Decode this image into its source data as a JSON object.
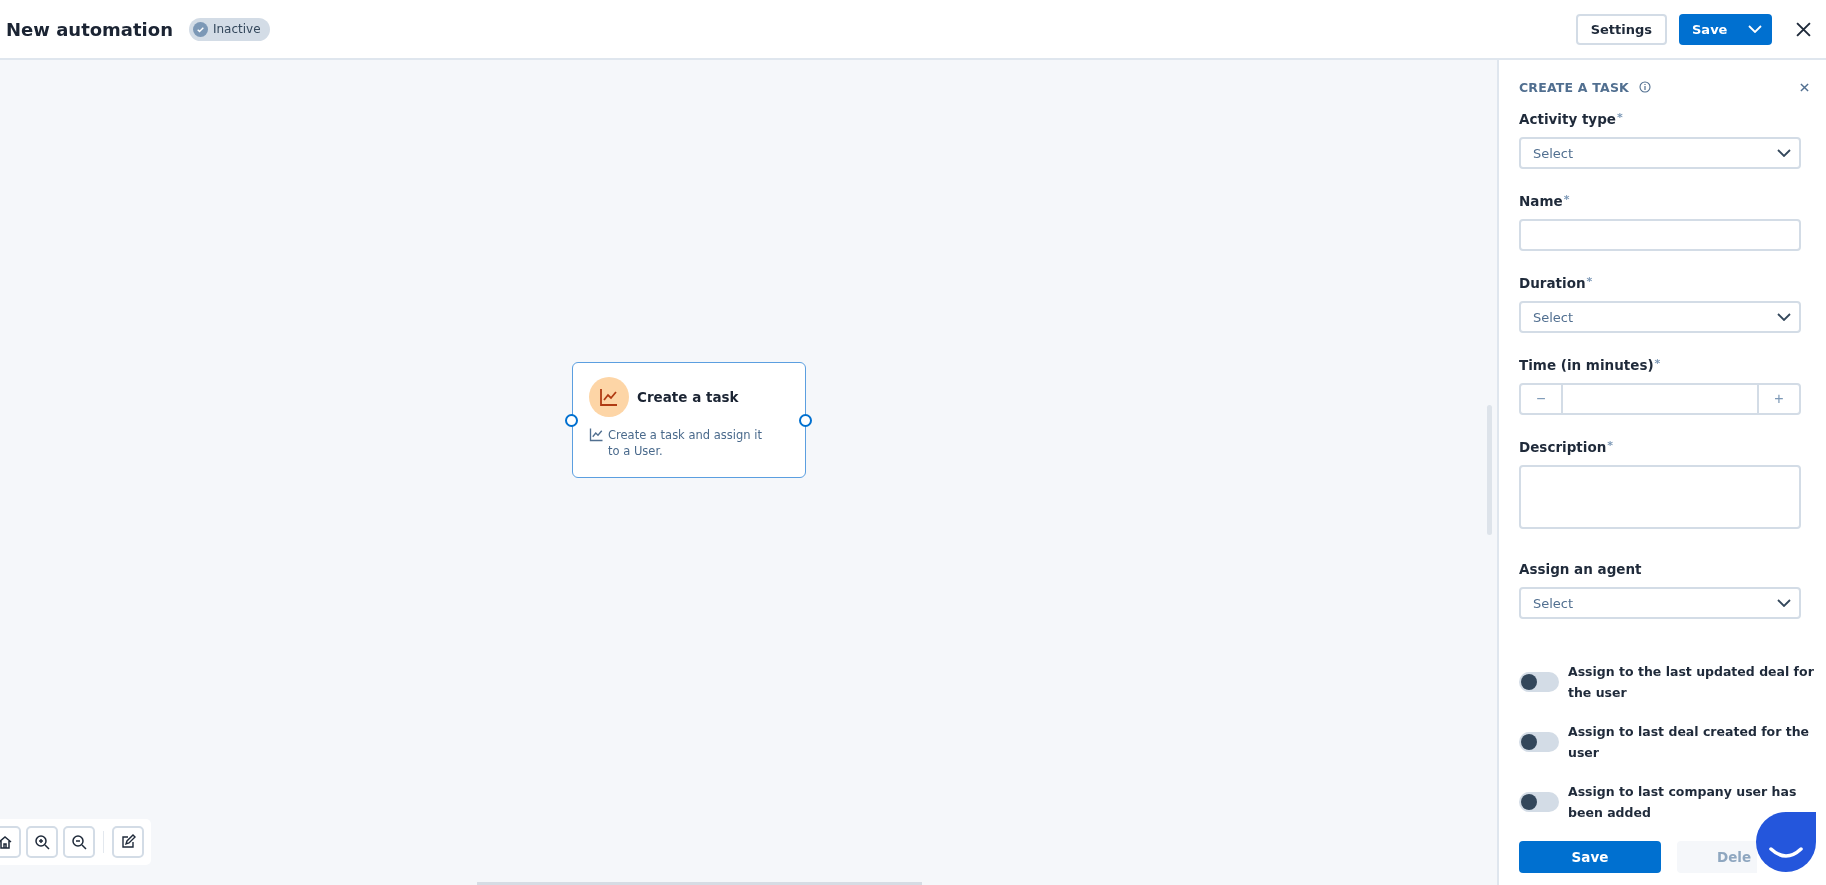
{
  "header": {
    "title": "New automation",
    "status": {
      "label": "Inactive",
      "active": false
    },
    "settings_button": "Settings",
    "save_button": "Save"
  },
  "canvas": {
    "node": {
      "title": "Create a task",
      "description": "Create a task and assign it to a User.",
      "selected": true
    }
  },
  "panel": {
    "title": "CREATE A TASK",
    "fields": [
      {
        "kind": "select",
        "label": "Activity type",
        "required_mark": "*",
        "placeholder": "Select"
      },
      {
        "kind": "text",
        "label": "Name",
        "required_mark": "*"
      },
      {
        "kind": "select",
        "label": "Duration",
        "required_mark": "*",
        "placeholder": "Select"
      },
      {
        "kind": "stepper",
        "label": "Time (in minutes)",
        "required_mark": "*",
        "minus": "−",
        "plus": "+"
      },
      {
        "kind": "textarea",
        "label": "Description",
        "required_mark": "*"
      },
      {
        "kind": "select",
        "label": "Assign an agent",
        "placeholder": "Select"
      }
    ],
    "toggles": [
      {
        "label": "Assign to the last updated deal for the user",
        "on": false
      },
      {
        "label": "Assign to last deal created for the user",
        "on": false
      },
      {
        "label": "Assign to last company user has been added",
        "on": false
      }
    ],
    "save_button": "Save",
    "delete_button": "Dele"
  }
}
